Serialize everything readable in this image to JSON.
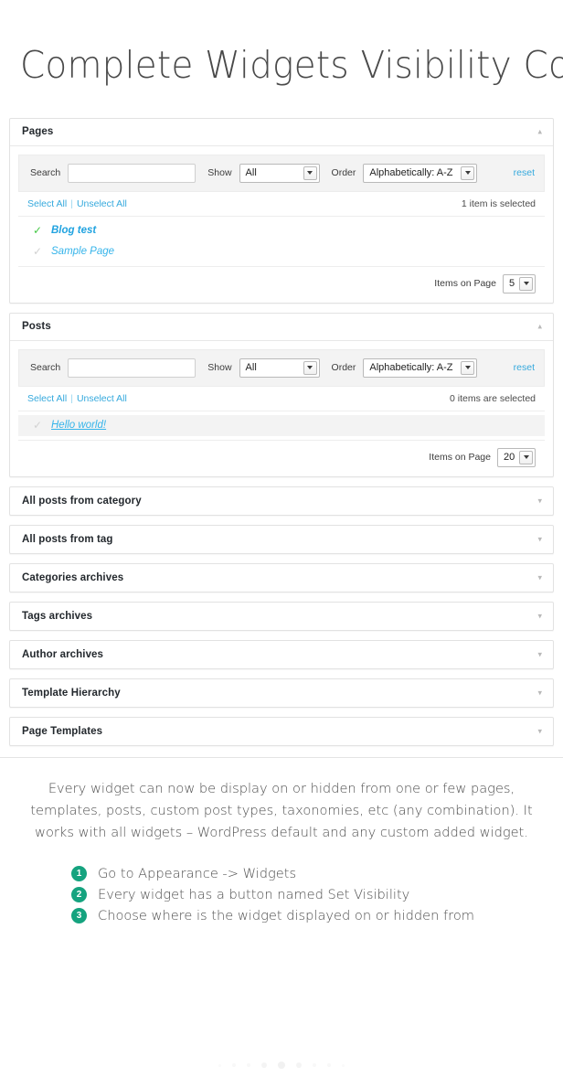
{
  "page": {
    "title": "Complete Widgets Visibility Control"
  },
  "panels": [
    {
      "title": "Pages",
      "expanded": true,
      "toggle_icon": "chevron-up-icon",
      "toggle_glyph": "▴",
      "filter": {
        "search_label": "Search",
        "search_value": "",
        "search_placeholder": "",
        "show_label": "Show",
        "show_value": "All",
        "order_label": "Order",
        "order_value": "Alphabetically: A-Z",
        "reset_label": "reset"
      },
      "select_all_label": "Select All",
      "separator": "|",
      "unselect_all_label": "Unselect All",
      "selection_count": "1 item is selected",
      "items": [
        {
          "label": "Blog test",
          "selected": true,
          "hover": false,
          "underlined": false
        },
        {
          "label": "Sample Page",
          "selected": false,
          "hover": false,
          "underlined": false
        }
      ],
      "items_on_page_label": "Items on Page",
      "items_on_page_value": "5"
    },
    {
      "title": "Posts",
      "expanded": true,
      "toggle_icon": "chevron-up-icon",
      "toggle_glyph": "▴",
      "filter": {
        "search_label": "Search",
        "search_value": "",
        "search_placeholder": "",
        "show_label": "Show",
        "show_value": "All",
        "order_label": "Order",
        "order_value": "Alphabetically: A-Z",
        "reset_label": "reset"
      },
      "select_all_label": "Select All",
      "separator": "|",
      "unselect_all_label": "Unselect All",
      "selection_count": "0 items are selected",
      "items": [
        {
          "label": "Hello world!",
          "selected": false,
          "hover": true,
          "underlined": true
        }
      ],
      "items_on_page_label": "Items on Page",
      "items_on_page_value": "20"
    }
  ],
  "collapsed_panels": [
    {
      "title": "All posts from category",
      "toggle_icon": "chevron-down-icon",
      "toggle_glyph": "▾"
    },
    {
      "title": "All posts from tag",
      "toggle_icon": "chevron-down-icon",
      "toggle_glyph": "▾"
    },
    {
      "title": "Categories archives",
      "toggle_icon": "chevron-down-icon",
      "toggle_glyph": "▾"
    },
    {
      "title": "Tags archives",
      "toggle_icon": "chevron-down-icon",
      "toggle_glyph": "▾"
    },
    {
      "title": "Author archives",
      "toggle_icon": "chevron-down-icon",
      "toggle_glyph": "▾"
    },
    {
      "title": "Template Hierarchy",
      "toggle_icon": "chevron-down-icon",
      "toggle_glyph": "▾"
    },
    {
      "title": "Page Templates",
      "toggle_icon": "chevron-down-icon",
      "toggle_glyph": "▾"
    }
  ],
  "description": {
    "paragraph": "Every widget can now be display on or hidden from one or few pages, templates, posts, custom post types, taxonomies, etc (any combination). It works with all widgets – WordPress default and any custom added widget.",
    "steps": [
      {
        "number": "1",
        "text": "Go to Appearance -> Widgets"
      },
      {
        "number": "2",
        "text": "Every widget has a button named Set Visibility"
      },
      {
        "number": "3",
        "text": "Choose where is the widget displayed on or hidden from"
      }
    ]
  },
  "carousel": {
    "dot_sizes": [
      "s1",
      "s2",
      "s2",
      "s3",
      "s4",
      "s3",
      "s2",
      "s2",
      "s1"
    ]
  },
  "colors": {
    "accent_blue": "#35a9dd",
    "item_blue": "#35b4ea",
    "check_green": "#46c947",
    "check_gray": "#d2d2d2",
    "step_badge": "#15a37f",
    "title_gray": "#4a4a4a"
  }
}
